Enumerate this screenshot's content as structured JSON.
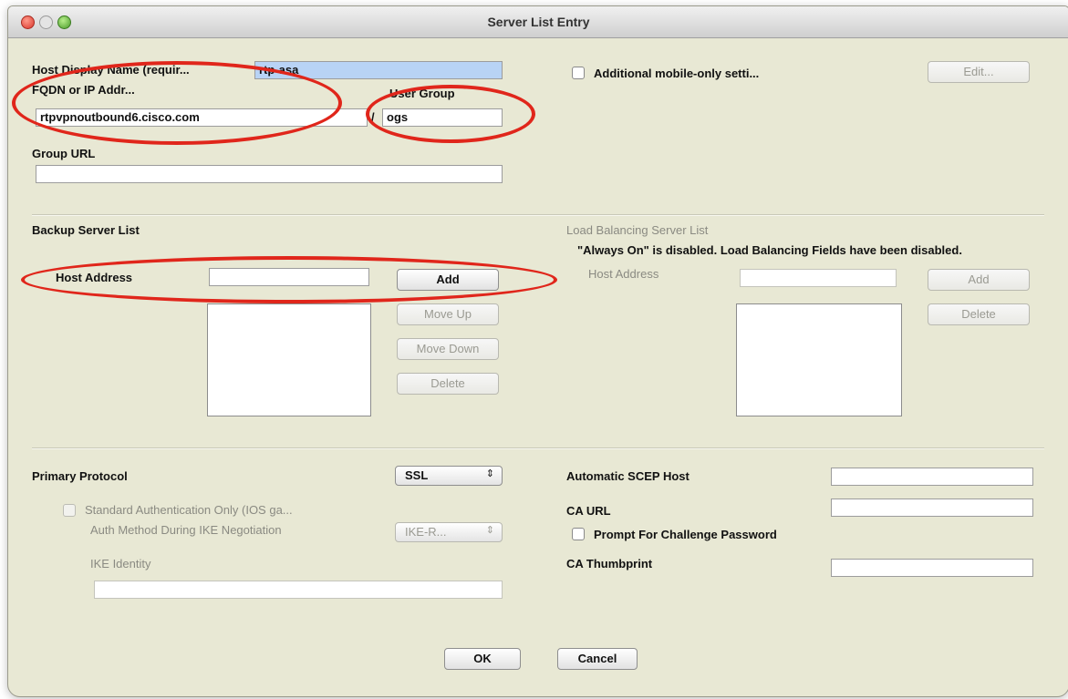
{
  "window": {
    "title": "Server List Entry"
  },
  "host": {
    "display_name_label": "Host Display Name (requir...",
    "display_name_value": "rtp-asa",
    "fqdn_label": "FQDN or IP Addr...",
    "fqdn_value": "rtpvpnoutbound6.cisco.com",
    "slash": "/",
    "user_group_label": "User Group",
    "user_group_value": "ogs",
    "group_url_label": "Group URL",
    "group_url_value": ""
  },
  "mobile": {
    "checkbox_label": "Additional mobile-only setti...",
    "edit_button": "Edit..."
  },
  "backup": {
    "heading": "Backup Server List",
    "host_address_label": "Host Address",
    "add": "Add",
    "move_up": "Move Up",
    "move_down": "Move Down",
    "delete": "Delete"
  },
  "load_balancing": {
    "heading": "Load Balancing Server List",
    "notice": "\"Always On\" is disabled.  Load Balancing Fields have been disabled.",
    "host_address_label": "Host Address",
    "add": "Add",
    "delete": "Delete"
  },
  "protocol": {
    "primary_label": "Primary Protocol",
    "primary_value": "SSL",
    "std_auth_label": "Standard Authentication Only (IOS ga...",
    "auth_method_label": "Auth Method During IKE Negotiation",
    "auth_method_value": "IKE-R...",
    "ike_identity_label": "IKE Identity"
  },
  "scep": {
    "host_label": "Automatic SCEP Host",
    "ca_url_label": "CA URL",
    "prompt_label": "Prompt For Challenge Password",
    "thumbprint_label": "CA Thumbprint"
  },
  "footer": {
    "ok": "OK",
    "cancel": "Cancel"
  },
  "icons": {
    "popup_arrows": "⇕"
  },
  "colors": {
    "annotation": "#e0261b",
    "selection": "#b8d3f5"
  }
}
